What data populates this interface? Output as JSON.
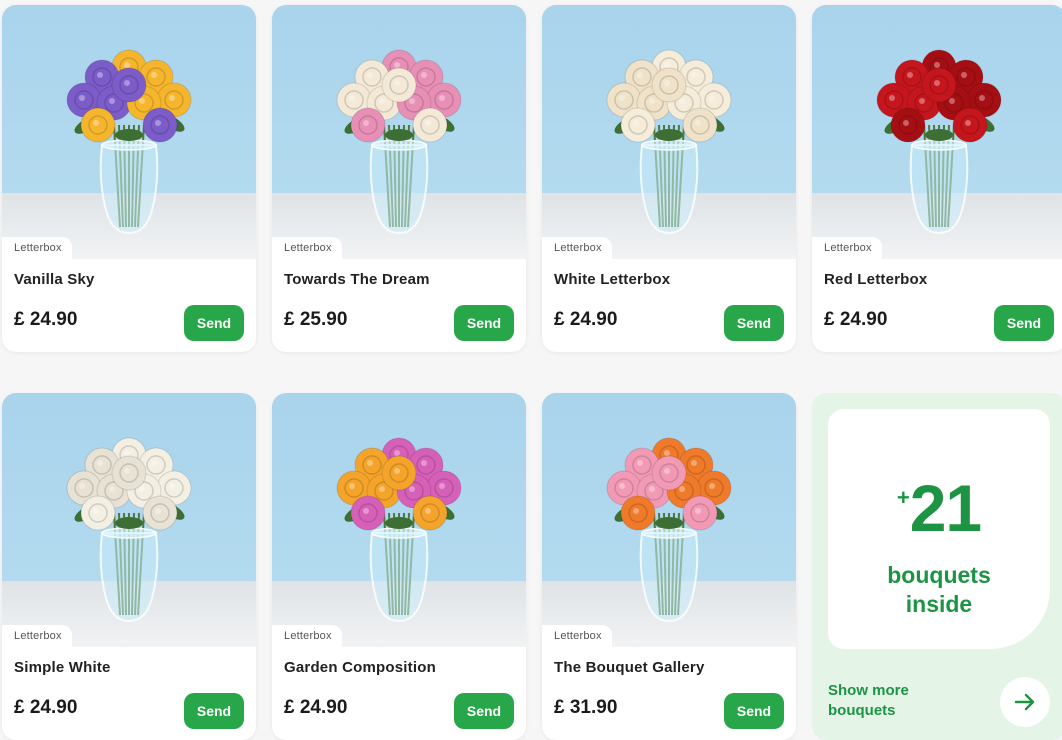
{
  "products": [
    {
      "tag": "Letterbox",
      "name": "Vanilla Sky",
      "price": "£ 24.90",
      "send_label": "Send",
      "flower_colors": [
        "#f5b62e",
        "#7b5cc8"
      ],
      "icon": "bouquet-yellow-purple"
    },
    {
      "tag": "Letterbox",
      "name": "Towards The Dream",
      "price": "£ 25.90",
      "send_label": "Send",
      "flower_colors": [
        "#f3e9d6",
        "#e88fb6"
      ],
      "icon": "bouquet-white-pink"
    },
    {
      "tag": "Letterbox",
      "name": "White Letterbox",
      "price": "£ 24.90",
      "send_label": "Send",
      "flower_colors": [
        "#f5ecd9",
        "#efe2c8"
      ],
      "icon": "bouquet-white-roses"
    },
    {
      "tag": "Letterbox",
      "name": "Red Letterbox",
      "price": "£ 24.90",
      "send_label": "Send",
      "flower_colors": [
        "#c4161c",
        "#a50f14"
      ],
      "icon": "bouquet-red-roses"
    },
    {
      "tag": "Letterbox",
      "name": "Simple White",
      "price": "£ 24.90",
      "send_label": "Send",
      "flower_colors": [
        "#f4efe3",
        "#e8e2d4"
      ],
      "icon": "bouquet-white-carnations"
    },
    {
      "tag": "Letterbox",
      "name": "Garden Composition",
      "price": "£ 24.90",
      "send_label": "Send",
      "flower_colors": [
        "#f4a42a",
        "#d660b8"
      ],
      "icon": "bouquet-orange-pink"
    },
    {
      "tag": "Letterbox",
      "name": "The Bouquet Gallery",
      "price": "£ 31.90",
      "send_label": "Send",
      "flower_colors": [
        "#ef7a2a",
        "#f29ab5"
      ],
      "icon": "bouquet-orange-lilies"
    }
  ],
  "more": {
    "plus": "+",
    "count": "21",
    "line1": "bouquets",
    "line2": "inside",
    "show_more": "Show more bouquets",
    "icon": "arrow-right-icon"
  },
  "colors": {
    "accent": "#27a74a",
    "accent_text": "#1d9444",
    "more_bg": "#e4f5e8",
    "photo_bg": "#a9d4ec"
  }
}
